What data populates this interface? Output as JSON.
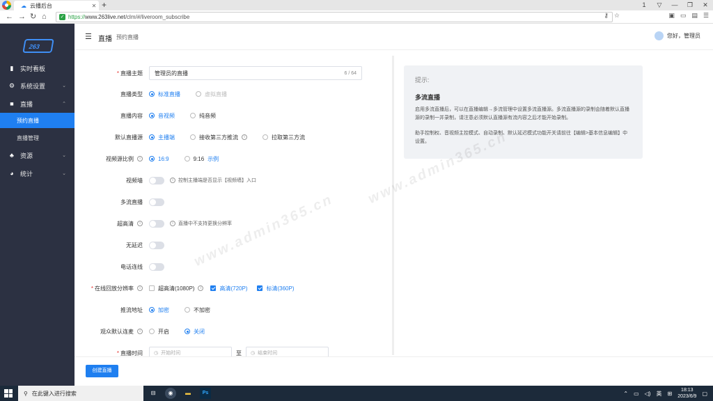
{
  "browser": {
    "tab_title": "云播后台",
    "url_scheme": "https://",
    "url_host": "www.263live.net",
    "url_path": "/clm/#/liveroom_subscribe",
    "window_controls": [
      "1",
      "▽",
      "—",
      "❐",
      "✕"
    ]
  },
  "sidebar": {
    "logo_text": "263",
    "items": [
      {
        "label": "实时看板",
        "icon": "chart-bar-icon"
      },
      {
        "label": "系统设置",
        "icon": "gear-icon"
      },
      {
        "label": "直播",
        "icon": "video-camera-icon"
      },
      {
        "label": "资源",
        "icon": "resources-icon"
      },
      {
        "label": "统计",
        "icon": "pie-chart-icon"
      }
    ],
    "live_sub": [
      "预约直播",
      "直播管理"
    ]
  },
  "header": {
    "title": "直播",
    "subtitle": "预约直播",
    "greeting": "您好，管理员"
  },
  "form": {
    "subject_label": "直播主题",
    "subject_value": "管理员的直播",
    "subject_count": "6 / 64",
    "type_label": "直播类型",
    "type_opts": [
      "标准直播",
      "虚拟直播"
    ],
    "content_label": "直播内容",
    "content_opts": [
      "音视频",
      "纯音频"
    ],
    "source_label": "默认直播源",
    "source_opts": [
      "主播端",
      "接收第三方推流",
      "拉取第三方流"
    ],
    "ratio_label": "视频源比例",
    "ratio_opts": [
      "16:9",
      "9:16"
    ],
    "ratio_link": "示例",
    "videowall_label": "视频墙",
    "videowall_hint": "控制主播端是否显示【视频墙】入口",
    "multistream_label": "多流直播",
    "hd_label": "超高清",
    "hd_hint": "直播中不支持更换分辨率",
    "nodelay_label": "无延迟",
    "phone_label": "电话连线",
    "playback_label": "在线回放分辨率",
    "playback_opts": [
      "超高清(1080P)",
      "高清(720P)",
      "标清(360P)"
    ],
    "push_label": "推流地址",
    "push_opts": [
      "加密",
      "不加密"
    ],
    "mic_label": "观众默认连麦",
    "mic_opts": [
      "开启",
      "关闭"
    ],
    "time_label": "直播时间",
    "time_start": "开始时间",
    "time_sep": "至",
    "time_end": "结束时间"
  },
  "tips": {
    "header": "提示:",
    "title": "多流直播",
    "p1": "启用多流直播后，可以在直播编辑→多流管理中设置多流直播源。多流直播源的录制会随着默认直播源的录制一并录制，请注意必须默认直播源有流内容之后才能开始录制。",
    "p2": "助手控制权、音视频主控模式、自动录制、默认延迟模式功能开关请前往【编辑>基本信息编辑】中设置。"
  },
  "footer": {
    "create_button": "创建直播"
  },
  "watermark": "www.admin365.cn",
  "taskbar": {
    "search_placeholder": "在此键入进行搜索",
    "time": "18:13",
    "date": "2023/6/9",
    "lang": "英"
  }
}
